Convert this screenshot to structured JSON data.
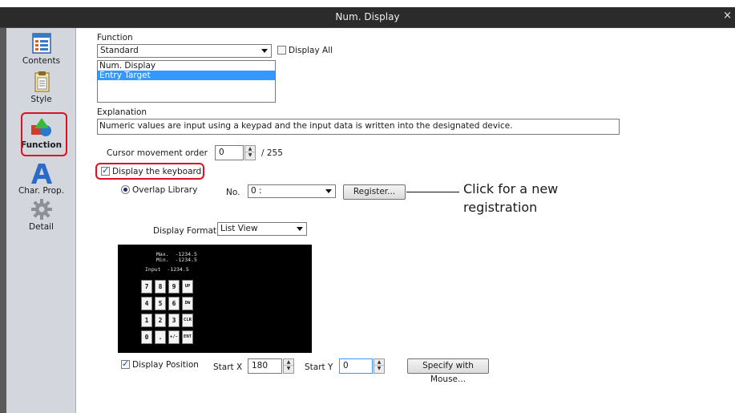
{
  "window": {
    "title": "Num. Display",
    "close_glyph": "×"
  },
  "sidebar": {
    "items": [
      {
        "label": "Contents",
        "icon": "contents-icon"
      },
      {
        "label": "Style",
        "icon": "style-icon"
      },
      {
        "label": "Function",
        "icon": "function-icon",
        "active": true
      },
      {
        "label": "Char. Prop.",
        "icon": "char-prop-icon"
      },
      {
        "label": "Detail",
        "icon": "detail-icon"
      }
    ]
  },
  "function": {
    "label": "Function",
    "selected": "Standard",
    "display_all_label": "Display All",
    "display_all_checked": false,
    "list": [
      "Num. Display",
      "Entry Target"
    ],
    "list_selected": "Entry Target"
  },
  "explanation": {
    "label": "Explanation",
    "text": "Numeric values are input using a keypad and the input data is written into the designated device."
  },
  "cursor": {
    "label": "Cursor movement order",
    "value": "0",
    "max": "/ 255"
  },
  "keyboard": {
    "display_label": "Display the keyboard",
    "display_checked": true,
    "overlap_label": "Overlap Library",
    "no_label": "No.",
    "no_value": "0 :",
    "register_label": "Register..."
  },
  "display_format": {
    "label": "Display Format",
    "value": "List View"
  },
  "preview": {
    "lines": [
      "Max.  -1234.5",
      "Min.  -1234.5",
      "Input  -1234.5"
    ],
    "keys": [
      [
        "7",
        "8",
        "9",
        "UP"
      ],
      [
        "4",
        "5",
        "6",
        "DW"
      ],
      [
        "1",
        "2",
        "3",
        "CLR"
      ],
      [
        "0",
        ".",
        "+/-",
        "ENT"
      ]
    ]
  },
  "position": {
    "display_label": "Display Position",
    "display_checked": true,
    "start_x_label": "Start X",
    "start_x_value": "180",
    "start_y_label": "Start Y",
    "start_y_value": "0",
    "specify_label": "Specify with Mouse..."
  },
  "callout": {
    "text": "Click for a new registration"
  },
  "colors": {
    "highlight_red": "#e0101e",
    "selection_blue": "#3399ff",
    "titlebar": "#2b2b2b",
    "sidebar": "#d3d7dd"
  }
}
